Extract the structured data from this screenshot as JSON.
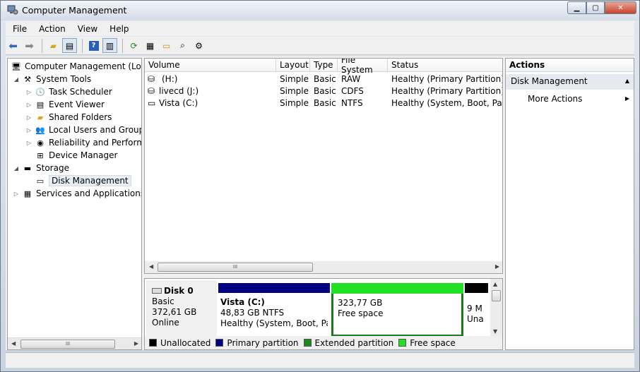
{
  "window": {
    "title": "Computer Management"
  },
  "menu": [
    "File",
    "Action",
    "View",
    "Help"
  ],
  "tree": {
    "root": "Computer Management (Local",
    "items": [
      {
        "label": "System Tools"
      },
      {
        "label": "Task Scheduler"
      },
      {
        "label": "Event Viewer"
      },
      {
        "label": "Shared Folders"
      },
      {
        "label": "Local Users and Groups"
      },
      {
        "label": "Reliability and Performa"
      },
      {
        "label": "Device Manager"
      },
      {
        "label": "Storage"
      },
      {
        "label": "Disk Management"
      },
      {
        "label": "Services and Applications"
      }
    ]
  },
  "volumes": {
    "columns": [
      "Volume",
      "Layout",
      "Type",
      "File System",
      "Status"
    ],
    "rows": [
      {
        "volume": "(H:)",
        "layout": "Simple",
        "type": "Basic",
        "fs": "RAW",
        "status": "Healthy (Primary Partition)"
      },
      {
        "volume": "livecd (J:)",
        "layout": "Simple",
        "type": "Basic",
        "fs": "CDFS",
        "status": "Healthy (Primary Partition)"
      },
      {
        "volume": "Vista (C:)",
        "layout": "Simple",
        "type": "Basic",
        "fs": "NTFS",
        "status": "Healthy (System, Boot, Page F"
      }
    ]
  },
  "disk": {
    "name": "Disk 0",
    "type": "Basic",
    "size": "372,61 GB",
    "state": "Online",
    "partitions": [
      {
        "title": "Vista  (C:)",
        "size": "48,83 GB NTFS",
        "status": "Healthy (System, Boot, Pag",
        "color": "#000080"
      },
      {
        "title": "",
        "size": "323,77 GB",
        "status": "Free space",
        "color": "#22e022"
      },
      {
        "title": "",
        "size": "9 M",
        "status": "Una",
        "color": "#000000"
      }
    ]
  },
  "legend": [
    {
      "label": "Unallocated",
      "color": "#000000"
    },
    {
      "label": "Primary partition",
      "color": "#000080"
    },
    {
      "label": "Extended partition",
      "color": "#1a8a1a"
    },
    {
      "label": "Free space",
      "color": "#22e022"
    }
  ],
  "actions": {
    "title": "Actions",
    "section": "Disk Management",
    "more": "More Actions"
  },
  "scroll_grip": "III"
}
